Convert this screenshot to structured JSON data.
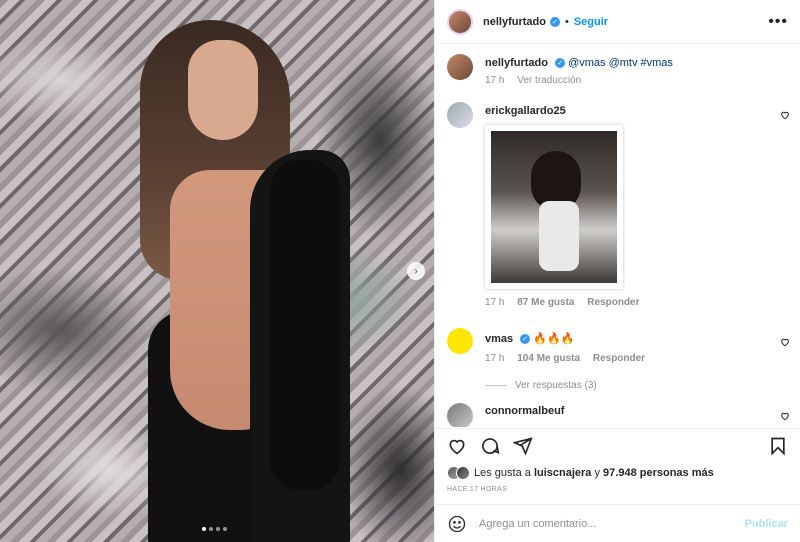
{
  "header": {
    "username": "nellyfurtado",
    "separator": "•",
    "follow_label": "Seguir",
    "more_label": "•••"
  },
  "caption": {
    "username": "nellyfurtado",
    "text": "@vmas @mtv #vmas",
    "time": "17 h",
    "translate": "Ver traducción"
  },
  "comments": [
    {
      "username": "erickgallardo25",
      "time": "17 h",
      "likes": "87 Me gusta",
      "reply": "Responder"
    },
    {
      "username": "vmas",
      "text": "🔥🔥🔥",
      "time": "17 h",
      "likes": "104 Me gusta",
      "reply": "Responder",
      "view_replies": "Ver respuestas (3)"
    },
    {
      "username": "connormalbeuf"
    }
  ],
  "likes": {
    "prefix": "Les gusta a ",
    "user": "luiscnajera",
    "middle": " y ",
    "count": "97.948 personas más"
  },
  "timestamp": "HACE 17 HORAS",
  "add_comment": {
    "placeholder": "Agrega un comentario...",
    "post_label": "Publicar"
  },
  "carousel": {
    "slide_count": 4,
    "active_index": 0
  },
  "colors": {
    "accent": "#0095f6",
    "verified": "#3897f0",
    "muted": "#8e8e8e",
    "text": "#262626"
  },
  "icons": [
    "heart-icon",
    "comment-icon",
    "share-icon",
    "bookmark-icon",
    "emoji-icon",
    "chevron-right-icon",
    "verified-icon",
    "more-icon"
  ]
}
